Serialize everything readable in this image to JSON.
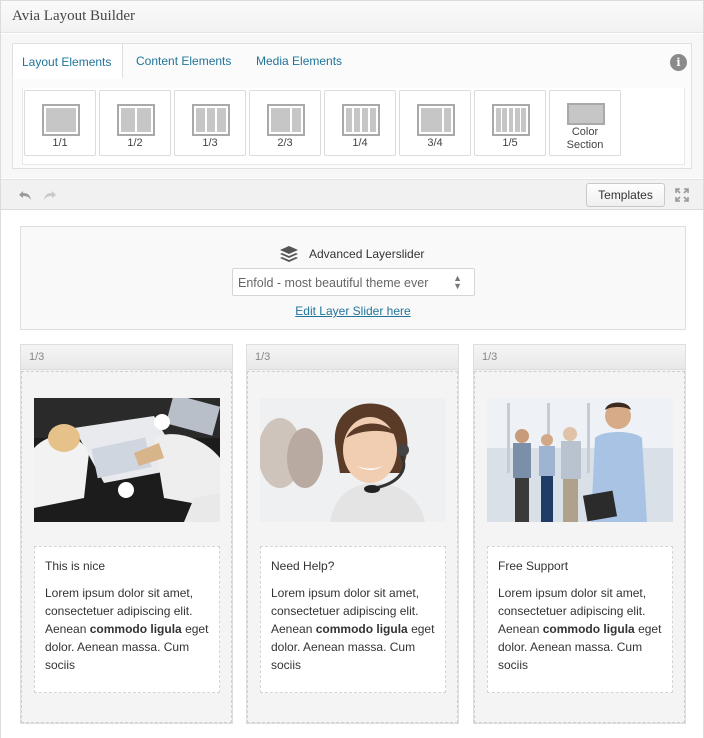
{
  "header": {
    "title": "Avia Layout Builder"
  },
  "tabs": [
    {
      "label": "Layout Elements",
      "active": true
    },
    {
      "label": "Content Elements",
      "active": false
    },
    {
      "label": "Media Elements",
      "active": false
    }
  ],
  "help_icon": "info-icon",
  "layout_tiles": [
    {
      "label": "1/1",
      "icon": "column-1-1-icon"
    },
    {
      "label": "1/2",
      "icon": "column-1-2-icon"
    },
    {
      "label": "1/3",
      "icon": "column-1-3-icon"
    },
    {
      "label": "2/3",
      "icon": "column-2-3-icon"
    },
    {
      "label": "1/4",
      "icon": "column-1-4-icon"
    },
    {
      "label": "3/4",
      "icon": "column-3-4-icon"
    },
    {
      "label": "1/5",
      "icon": "column-1-5-icon"
    },
    {
      "label_line1": "Color",
      "label_line2": "Section",
      "icon": "color-section-icon"
    }
  ],
  "toolbar": {
    "undo_icon": "undo-icon",
    "redo_icon": "redo-icon",
    "templates_label": "Templates",
    "fullscreen_icon": "fullscreen-icon"
  },
  "layerslider": {
    "title": "Advanced Layerslider",
    "selected": "Enfold - most beautiful theme ever",
    "edit_link": "Edit Layer Slider here"
  },
  "columns": [
    {
      "size": "1/3",
      "photo": "business-meeting-photo",
      "title": "This is nice",
      "body_pre": "Lorem ipsum dolor sit amet, consectetuer adipiscing elit. Aenean ",
      "body_bold": "commodo ligula",
      "body_post": " eget dolor. Aenean massa. Cum sociis"
    },
    {
      "size": "1/3",
      "photo": "headset-support-photo",
      "title": "Need Help?",
      "body_pre": "Lorem ipsum dolor sit amet, consectetuer adipiscing elit. Aenean ",
      "body_bold": "commodo ligula",
      "body_post": " eget dolor. Aenean massa. Cum sociis"
    },
    {
      "size": "1/3",
      "photo": "office-team-photo",
      "title": "Free Support",
      "body_pre": "Lorem ipsum dolor sit amet, consectetuer adipiscing elit. Aenean ",
      "body_bold": "commodo ligula",
      "body_post": " eget dolor. Aenean massa. Cum sociis"
    }
  ]
}
